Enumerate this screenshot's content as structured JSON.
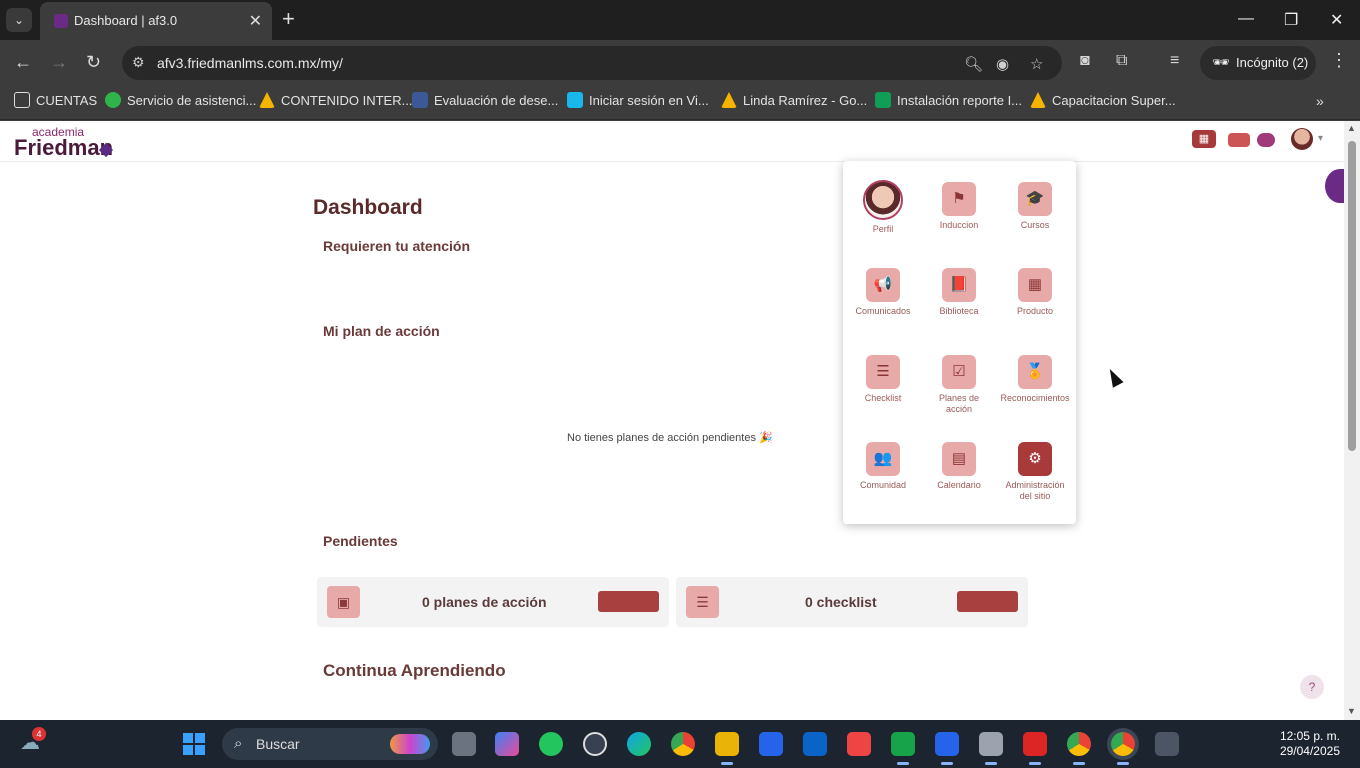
{
  "browser": {
    "tab_title": "Dashboard | af3.0",
    "tab_close": "✕",
    "new_tab": "+",
    "url": "afv3.friedmanlms.com.mx/my/",
    "incognito_label": "Incógnito (2)",
    "window_controls": [
      "—",
      "❐",
      "✕"
    ],
    "bookmarks": [
      {
        "label": "CUENTAS",
        "color": "transparent"
      },
      {
        "label": "Servicio de asistenci...",
        "color": "#2fb34a"
      },
      {
        "label": "CONTENIDO INTER...",
        "color": "#f4b400"
      },
      {
        "label": "Evaluación de dese...",
        "color": "#3b5998"
      },
      {
        "label": "Iniciar sesión en Vi...",
        "color": "#1ab7ea"
      },
      {
        "label": "Linda Ramírez - Go...",
        "color": "#f4b400"
      },
      {
        "label": "Instalación reporte I...",
        "color": "#0f9d58"
      },
      {
        "label": "Capacitacion Super...",
        "color": "#f4b400"
      }
    ]
  },
  "site": {
    "logo_small": "academia",
    "logo_big": "Friedman",
    "apps_icon": "▦"
  },
  "main": {
    "title": "Dashboard",
    "attention_heading": "Requieren tu atención",
    "plan_heading": "Mi plan de acción",
    "empty_plans": "No tienes planes de acción pendientes 🎉",
    "pending_heading": "Pendientes",
    "pending_cards": [
      {
        "label": "0 planes de acción",
        "icon": "clipboard-icon"
      },
      {
        "label": "0 checklist",
        "icon": "list-icon"
      }
    ],
    "continue_heading": "Continua Aprendiendo",
    "help": "?"
  },
  "apps_menu": {
    "items": [
      {
        "label": "Perfil",
        "icon": "avatar"
      },
      {
        "label": "Induccion",
        "icon": "flag-icon",
        "glyph": "⚑"
      },
      {
        "label": "Cursos",
        "icon": "graduation-cap-icon",
        "glyph": "🎓"
      },
      {
        "label": "Comunicados",
        "icon": "megaphone-icon",
        "glyph": "📢"
      },
      {
        "label": "Biblioteca",
        "icon": "book-icon",
        "glyph": "📕"
      },
      {
        "label": "Producto",
        "icon": "product-grid-icon",
        "glyph": "▦"
      },
      {
        "label": "Checklist",
        "icon": "checklist-icon",
        "glyph": "☰"
      },
      {
        "label": "Planes de acción",
        "icon": "check-square-icon",
        "glyph": "☑"
      },
      {
        "label": "Reconocimientos",
        "icon": "medal-icon",
        "glyph": "🏅"
      },
      {
        "label": "Comunidad",
        "icon": "users-icon",
        "glyph": "👥"
      },
      {
        "label": "Calendario",
        "icon": "calendar-icon",
        "glyph": "▤"
      },
      {
        "label": "Administración del sitio",
        "icon": "gear-icon",
        "glyph": "⚙"
      }
    ]
  },
  "taskbar": {
    "search_label": "Buscar",
    "badge_count": "4",
    "time": "12:05 p. m.",
    "date": "29/04/2025"
  }
}
